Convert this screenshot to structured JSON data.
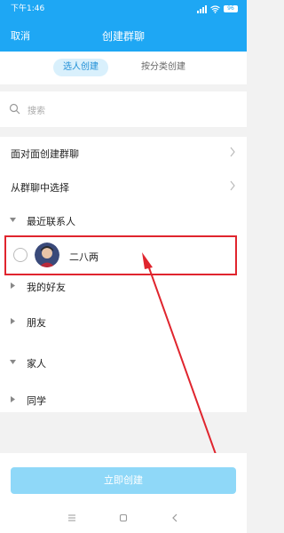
{
  "status_bar": {
    "time": "下午1:46",
    "battery": "96"
  },
  "navbar": {
    "cancel_label": "取消",
    "title": "创建群聊"
  },
  "modes": {
    "active_label": "选人创建",
    "inactive_label": "按分类创建"
  },
  "search": {
    "placeholder": "搜索"
  },
  "list": {
    "face_to_face": "面对面创建群聊",
    "from_group": "从群聊中选择",
    "recent_header": "最近联系人",
    "recent_contact": "二八两",
    "groups": [
      "我的好友",
      "朋友",
      "家人",
      "同学"
    ]
  },
  "footer": {
    "create_label": "立即创建"
  },
  "colors": {
    "accent": "#1ea7f4",
    "highlight": "#e0252e",
    "button_disabled": "#8fd8f8"
  }
}
